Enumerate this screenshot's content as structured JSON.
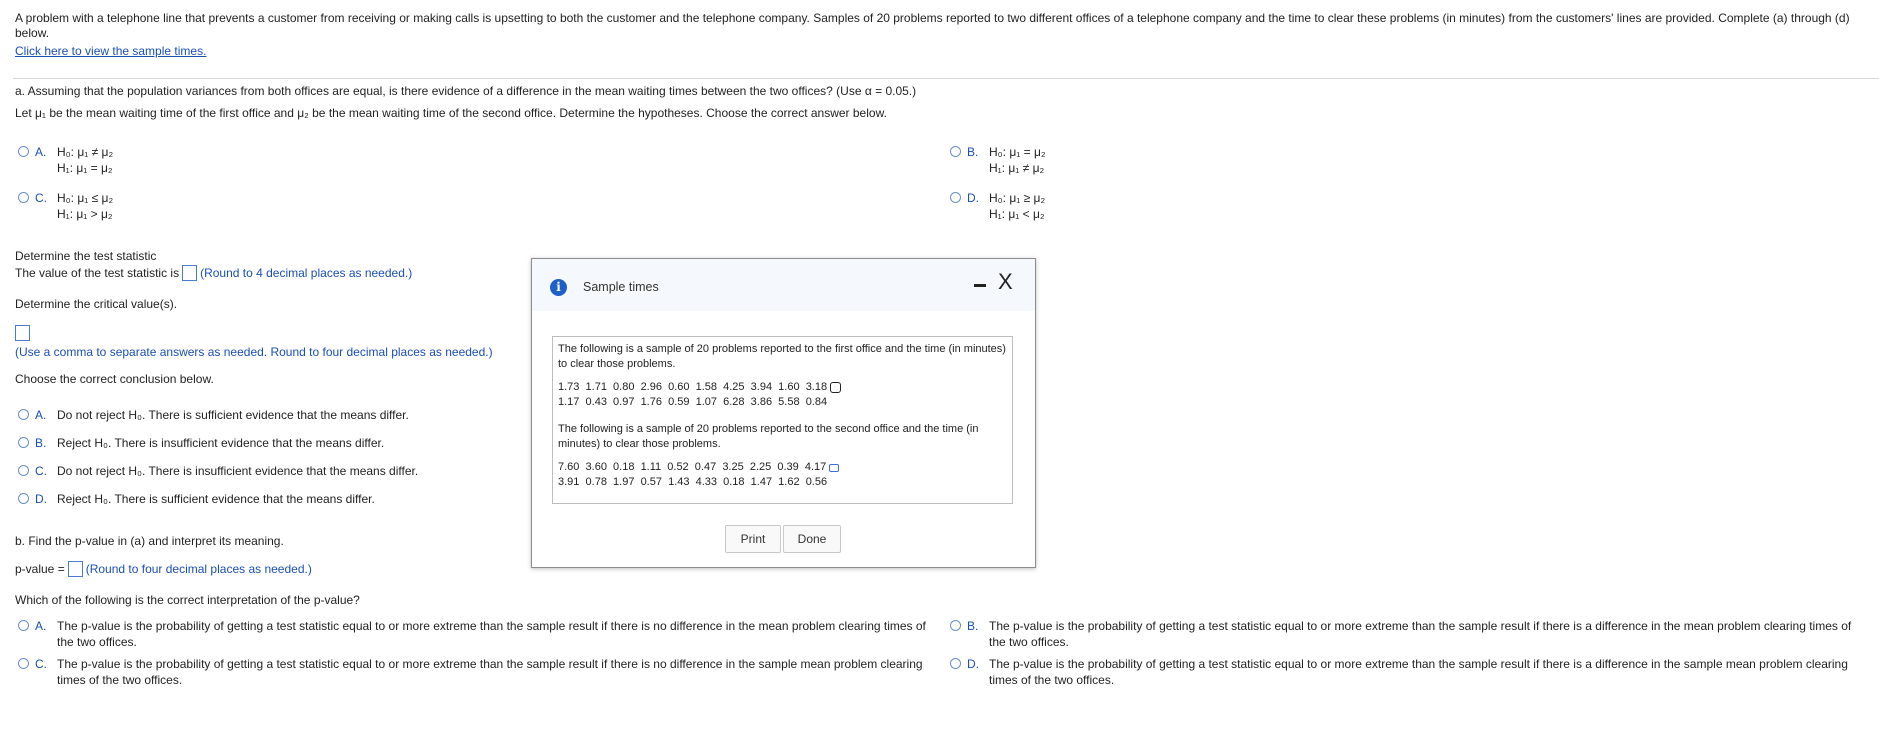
{
  "intro": {
    "text": "A problem with a telephone line that prevents a customer from receiving or making calls is upsetting to both the customer and the telephone company. Samples of 20 problems reported to two different offices of a telephone company and the time to clear these problems (in minutes) from the customers' lines are provided. Complete (a) through (d) below.",
    "link": "Click here to view the sample times."
  },
  "part_a": {
    "question": "a. Assuming that the population variances from both offices are equal, is there evidence of a difference in the mean waiting times between the two offices? (Use α = 0.05.)",
    "let_text": "Let μ₁ be the mean waiting time of the first office and μ₂ be the mean waiting time of the second office. Determine the hypotheses. Choose the correct answer below.",
    "hyp_options": [
      {
        "letter": "A.",
        "h0": "H₀: μ₁ ≠ μ₂",
        "h1": "H₁: μ₁ = μ₂"
      },
      {
        "letter": "B.",
        "h0": "H₀: μ₁ = μ₂",
        "h1": "H₁: μ₁ ≠ μ₂"
      },
      {
        "letter": "C.",
        "h0": "H₀: μ₁ ≤ μ₂",
        "h1": "H₁: μ₁ > μ₂"
      },
      {
        "letter": "D.",
        "h0": "H₀: μ₁ ≥ μ₂",
        "h1": "H₁: μ₁ < μ₂"
      }
    ],
    "test_stat_heading": "Determine the test statistic",
    "test_stat_label": "The value of the test statistic is",
    "test_stat_hint": "(Round to 4 decimal places as needed.)",
    "critical_heading": "Determine the critical value(s).",
    "critical_hint": "(Use a comma to separate answers as needed. Round to four decimal places as needed.)",
    "conclusion_heading": "Choose the correct conclusion below.",
    "conclusions": [
      {
        "letter": "A.",
        "text": "Do not reject H₀. There is sufficient evidence that the means differ."
      },
      {
        "letter": "B.",
        "text": "Reject H₀. There is insufficient evidence that the means differ."
      },
      {
        "letter": "C.",
        "text": "Do not reject H₀. There is insufficient evidence that the means differ."
      },
      {
        "letter": "D.",
        "text": "Reject H₀. There is sufficient evidence that the means differ."
      }
    ]
  },
  "part_b": {
    "question": "b. Find the p-value in (a) and interpret its meaning.",
    "pvalue_label": "p-value =",
    "pvalue_hint": "(Round to four decimal places as needed.)",
    "interp_heading": "Which of the following is the correct interpretation of the p-value?",
    "interpretations": [
      {
        "letter": "A.",
        "line1": "The p-value is the probability of getting a test statistic equal to or more extreme than the sample result if there is no difference in the mean problem clearing times of",
        "line2": "the two offices."
      },
      {
        "letter": "B.",
        "line1": "The p-value is the probability of getting a test statistic equal to or more extreme than the sample result if there is a difference in the mean problem clearing times of",
        "line2": "the two offices."
      },
      {
        "letter": "C.",
        "line1": "The p-value is the probability of getting a test statistic equal to or more extreme than the sample result if there is no difference in the sample mean problem clearing",
        "line2": "times of the two offices."
      },
      {
        "letter": "D.",
        "line1": "The p-value is the probability of getting a test statistic equal to or more extreme than the sample result if there is a difference in the sample mean problem clearing",
        "line2": "times of the two offices."
      }
    ]
  },
  "dialog": {
    "title": "Sample times",
    "minimize_symbol": "–",
    "close_symbol": "X",
    "office1_text": "The following is a sample of 20 problems reported to the first office and the time (in minutes) to clear those problems.",
    "office1_row1": "1.73  1.71  0.80  2.96  0.60  1.58  4.25  3.94  1.60  3.18",
    "office1_row2": "1.17  0.43  0.97  1.76  0.59  1.07  6.28  3.86  5.58  0.84",
    "office2_text": "The following is a sample of 20 problems reported to the second office and the time (in minutes) to clear those problems.",
    "office2_row1": "7.60  3.60  0.18  1.11  0.52  0.47  3.25  2.25  0.39  4.17",
    "office2_row2": "3.91  0.78  1.97  0.57  1.43  4.33  0.18  1.47  1.62  0.56",
    "print_label": "Print",
    "done_label": "Done"
  }
}
